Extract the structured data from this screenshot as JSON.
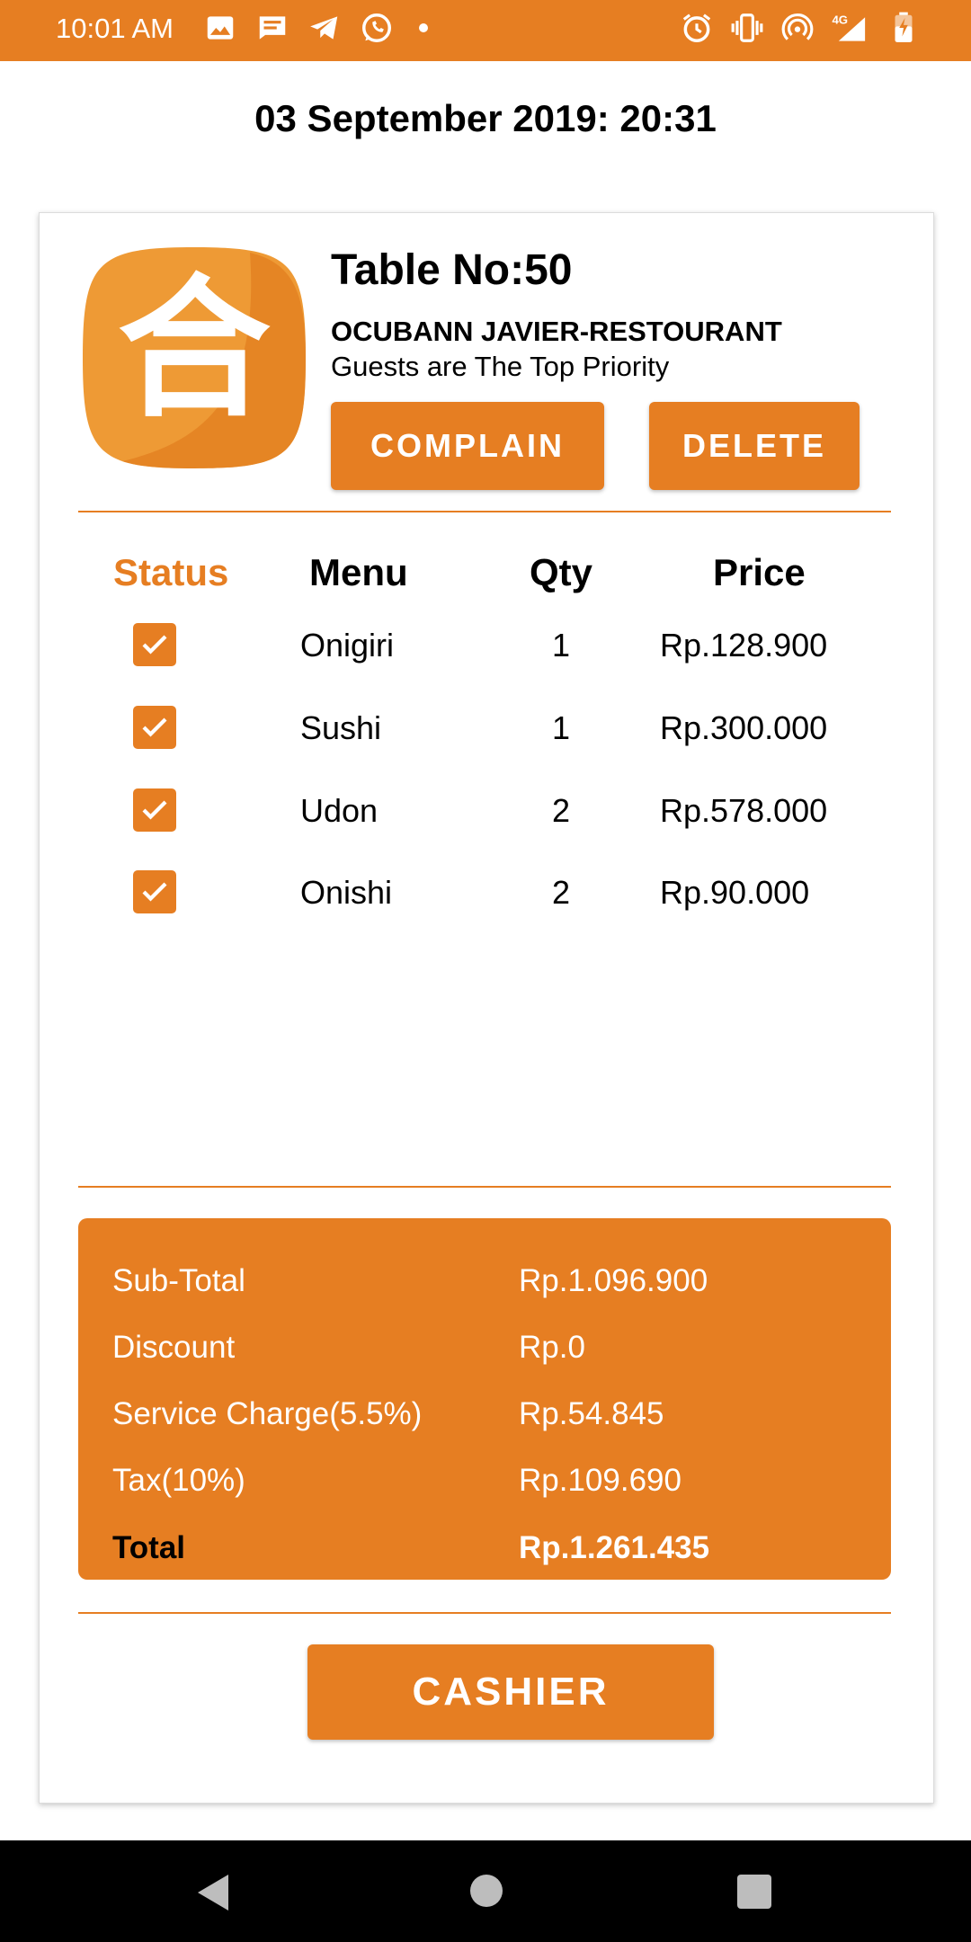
{
  "status_bar": {
    "time": "10:01 AM",
    "left_icons": [
      "image-icon",
      "message-icon",
      "telegram-icon",
      "whatsapp-icon",
      "notification-dot-icon"
    ],
    "right_icons": [
      "alarm-icon",
      "vibrate-icon",
      "hotspot-icon",
      "signal-4g-icon",
      "battery-icon"
    ],
    "network_label": "4G"
  },
  "page": {
    "date_time": "03 September 2019: 20:31"
  },
  "order": {
    "table_no": "Table No:50",
    "restaurant_name": "OCUBANN JAVIER-RESTOURANT",
    "tagline": "Guests are The Top Priority",
    "logo_glyph": "合",
    "buttons": {
      "complain": "COMPLAIN",
      "delete": "DELETE",
      "cashier": "CASHIER"
    },
    "columns": {
      "status": "Status",
      "menu": "Menu",
      "qty": "Qty",
      "price": "Price"
    },
    "items": [
      {
        "checked": true,
        "menu": "Onigiri",
        "qty": "1",
        "price": "Rp.128.900"
      },
      {
        "checked": true,
        "menu": "Sushi",
        "qty": "1",
        "price": "Rp.300.000"
      },
      {
        "checked": true,
        "menu": "Udon",
        "qty": "2",
        "price": "Rp.578.000"
      },
      {
        "checked": true,
        "menu": "Onishi",
        "qty": "2",
        "price": "Rp.90.000"
      }
    ],
    "summary": [
      {
        "label": "Sub-Total",
        "value": "Rp.1.096.900"
      },
      {
        "label": "Discount",
        "value": "Rp.0"
      },
      {
        "label": "Service Charge(5.5%)",
        "value": "Rp.54.845"
      },
      {
        "label": "Tax(10%)",
        "value": "Rp.109.690"
      },
      {
        "label": "Total",
        "value": "Rp.1.261.435"
      }
    ]
  },
  "colors": {
    "accent": "#E67E22",
    "white": "#ffffff",
    "nav_background": "#000000"
  },
  "nav_bar": {
    "icons": [
      "back-icon",
      "home-icon",
      "recents-icon"
    ]
  }
}
